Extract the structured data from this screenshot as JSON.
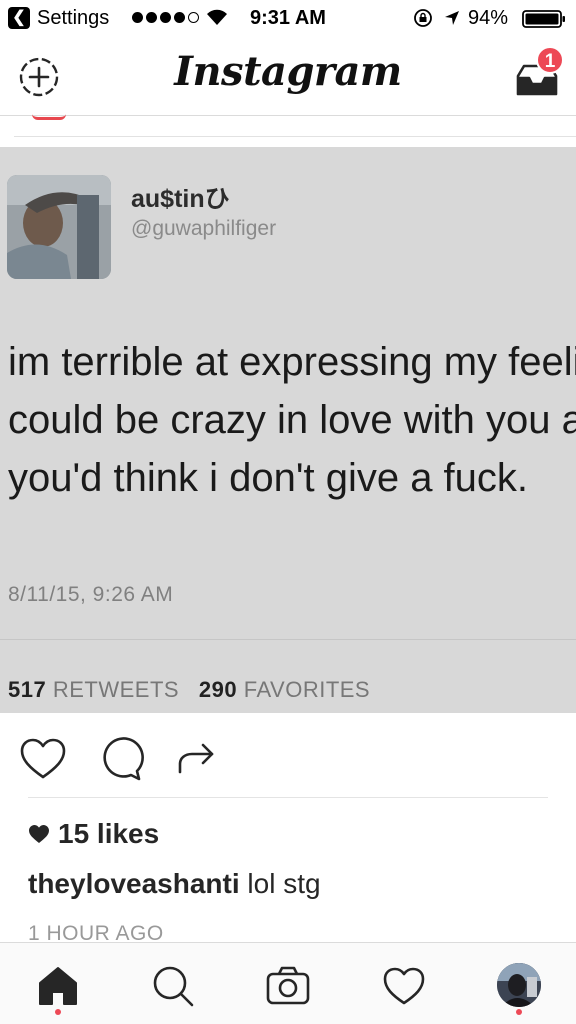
{
  "status_bar": {
    "back_label": "Settings",
    "time": "9:31 AM",
    "battery": "94%",
    "signal_bars_filled": 4,
    "signal_bars_total": 5
  },
  "header": {
    "logo": "Instagram",
    "notification_count": "1"
  },
  "post": {
    "tweet": {
      "display_name": "au$tinひ",
      "handle": "@guwaphilfiger",
      "text": "im terrible at expressing my feelings i could be crazy in love with you and you'd think i don't give a fuck.",
      "timestamp": "8/11/15, 9:26 AM",
      "retweets_count": "517",
      "retweets_label": "RETWEETS",
      "favorites_count": "290",
      "favorites_label": "FAVORITES"
    },
    "likes": "15 likes",
    "caption_user": "theyloveashanti",
    "caption_text": "lol stg",
    "time_ago": "1 HOUR AGO"
  },
  "icons": {
    "add_story": "add-story-icon",
    "inbox": "inbox-icon",
    "like": "heart-icon",
    "comment": "comment-icon",
    "share": "share-icon",
    "home": "home-icon",
    "search": "search-icon",
    "camera": "camera-icon",
    "activity": "heart-icon",
    "profile": "profile-avatar"
  },
  "colors": {
    "badge": "#ed4956",
    "text": "#262626",
    "muted": "#999999"
  }
}
